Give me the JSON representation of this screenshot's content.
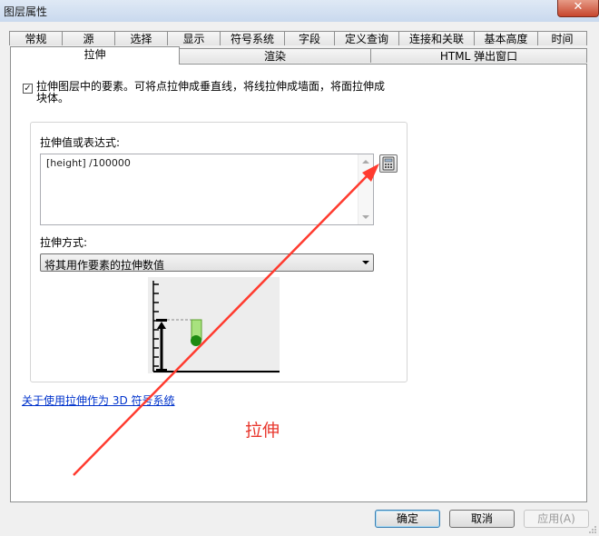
{
  "window": {
    "title": "图层属性",
    "close_label": "✕"
  },
  "tabs_row1": [
    {
      "label": "常规"
    },
    {
      "label": "源"
    },
    {
      "label": "选择"
    },
    {
      "label": "显示"
    },
    {
      "label": "符号系统"
    },
    {
      "label": "字段"
    },
    {
      "label": "定义查询"
    },
    {
      "label": "连接和关联"
    },
    {
      "label": "基本高度"
    },
    {
      "label": "时间"
    }
  ],
  "tabs_row2": [
    {
      "label": "拉伸"
    },
    {
      "label": "渲染"
    },
    {
      "label": "HTML 弹出窗口"
    }
  ],
  "extrude": {
    "checkbox_checked": true,
    "checkbox_label": "拉伸图层中的要素。可将点拉伸成垂直线，将线拉伸成墙面，将面拉伸成块体。",
    "value_label": "拉伸值或表达式:",
    "expression": "[height] /100000",
    "method_label": "拉伸方式:",
    "method_value": "将其用作要素的拉伸数值",
    "help_link": "关于使用拉伸作为 3D 符号系统"
  },
  "annotation": {
    "text": "拉伸",
    "color": "#e8362c"
  },
  "buttons": {
    "ok": "确定",
    "cancel": "取消",
    "apply": "应用(A)"
  },
  "icons": {
    "calculator": "calculator-icon",
    "dropdown": "chevron-down-icon"
  }
}
